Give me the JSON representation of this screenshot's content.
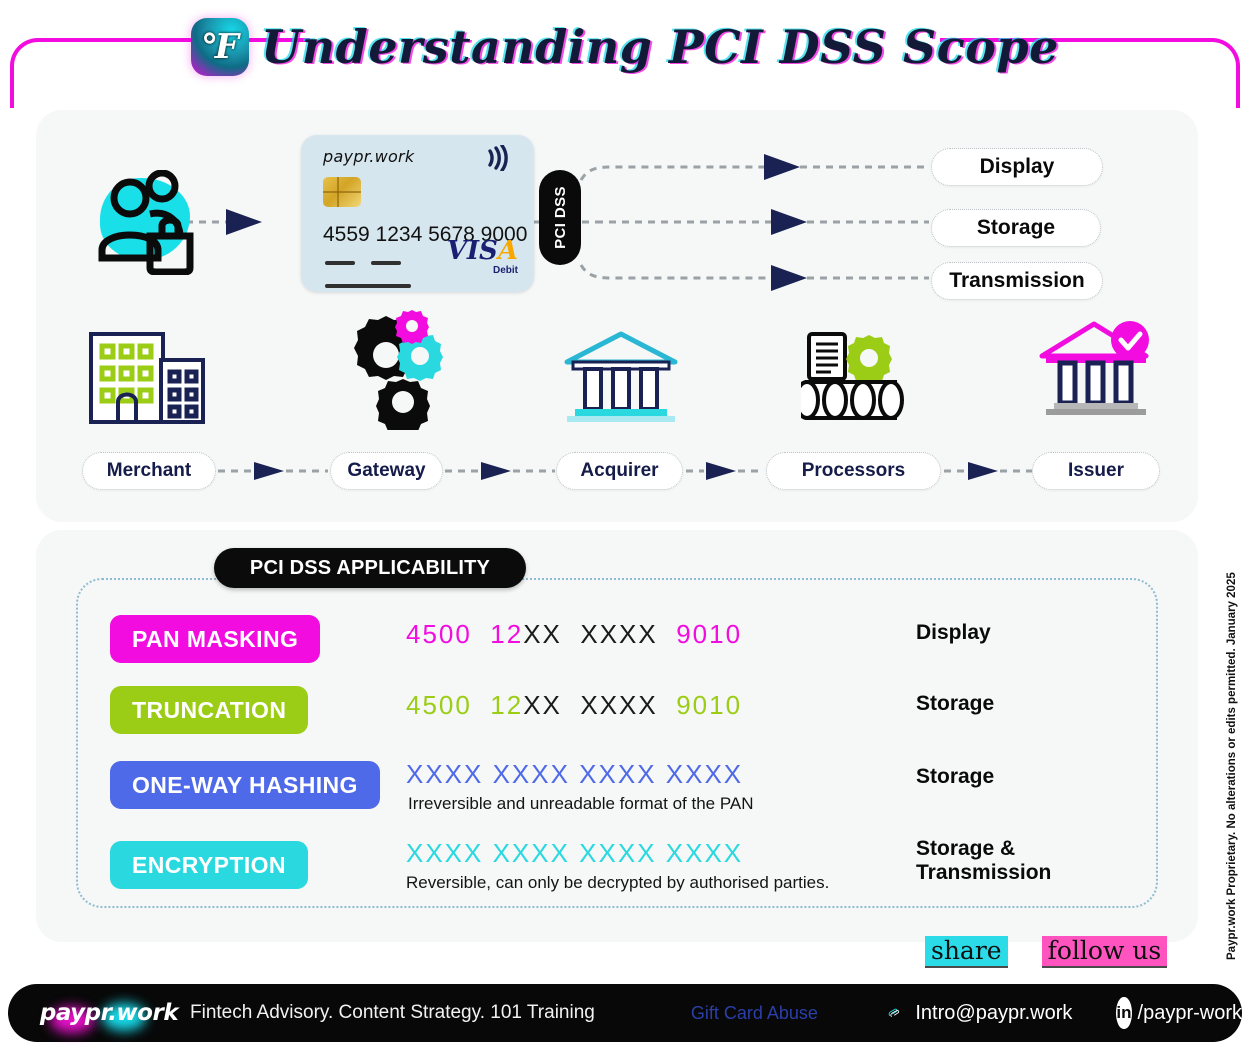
{
  "header": {
    "title": "Understanding PCI DSS Scope",
    "brand_icon": "paypr-swoosh-icon",
    "frame_color": "#f20ce0"
  },
  "flow": {
    "customers_icon": "customers-with-bag-icon",
    "card": {
      "brand": "paypr.work",
      "number": "4559 1234 5678 9000",
      "network": "VISA",
      "network_sub": "Debit",
      "contactless_icon": "contactless-icon",
      "chip_icon": "emv-chip-icon"
    },
    "pci_badge": "PCI DSS",
    "outputs": [
      {
        "label": "Display"
      },
      {
        "label": "Storage"
      },
      {
        "label": "Transmission"
      }
    ],
    "pipeline": [
      {
        "label": "Merchant",
        "icon": "buildings-icon"
      },
      {
        "label": "Gateway",
        "icon": "gears-icon"
      },
      {
        "label": "Acquirer",
        "icon": "bank-icon"
      },
      {
        "label": "Processors",
        "icon": "database-document-gear-icon"
      },
      {
        "label": "Issuer",
        "icon": "bank-verified-icon"
      }
    ]
  },
  "applicability": {
    "title": "PCI DSS APPLICABILITY",
    "rows": [
      {
        "tag": "PAN MASKING",
        "tag_color": "#f20ce0",
        "pan_visible_prefix": "4500",
        "pan_visible_mid": "12",
        "pan_mask_mid": "XX",
        "pan_mask_block": "XXXX",
        "pan_visible_suffix": "9010",
        "pan_color": "#f20ce0",
        "caption": "",
        "scope": "Display"
      },
      {
        "tag": "TRUNCATION",
        "tag_color": "#9ccd16",
        "pan_visible_prefix": "4500",
        "pan_visible_mid": "12",
        "pan_mask_mid": "XX",
        "pan_mask_block": "XXXX",
        "pan_visible_suffix": "9010",
        "pan_color": "#9ccd16",
        "caption": "",
        "scope": "Storage"
      },
      {
        "tag": "ONE-WAY HASHING",
        "tag_color": "#4f6ae8",
        "pan_full": "XXXX XXXX XXXX XXXX",
        "pan_color": "#4f6ae8",
        "caption": "Irreversible and unreadable format of the PAN",
        "scope": "Storage"
      },
      {
        "tag": "ENCRYPTION",
        "tag_color": "#2ad9e0",
        "pan_full": "XXXX XXXX XXXX XXXX",
        "pan_color": "#2ad9e0",
        "caption": "Reversible, can only be decrypted by authorised parties.",
        "scope": "Storage &\nTransmission"
      }
    ]
  },
  "copyright": "Paypr.work Proprietary. No alterations or edits permitted. January 2025",
  "social": {
    "share_label": "share",
    "follow_label": "follow us",
    "share_highlight": "#2bdbe8",
    "follow_highlight": "#ff54c0"
  },
  "footer": {
    "logo": "paypr.work",
    "tagline": "Fintech Advisory. Content Strategy. 101 Training",
    "gift_link": "Gift Card Abuse",
    "email": "Intro@paypr.work",
    "linkedin": "/paypr-work",
    "clip_icon": "paperclip-icon",
    "linkedin_icon": "linkedin-icon"
  }
}
